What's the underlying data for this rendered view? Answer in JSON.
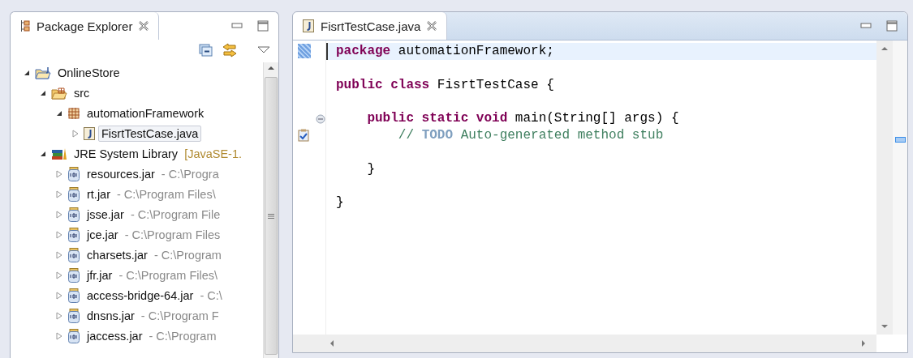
{
  "package_explorer": {
    "tab": {
      "title": "Package Explorer",
      "selected": true
    },
    "tree": [
      {
        "kind": "project",
        "label": "OnlineStore",
        "expanded": true,
        "selected": false,
        "children": [
          {
            "kind": "source-folder",
            "label": "src",
            "expanded": true,
            "selected": false,
            "children": [
              {
                "kind": "package",
                "label": "automationFramework",
                "expanded": true,
                "selected": false,
                "children": [
                  {
                    "kind": "java-file",
                    "label": "FisrtTestCase.java",
                    "expanded": false,
                    "selected": true
                  }
                ]
              }
            ]
          },
          {
            "kind": "library",
            "label": "JRE System Library",
            "decoration": "[JavaSE-1.",
            "expanded": true,
            "selected": false,
            "children": [
              {
                "kind": "jar",
                "label": "resources.jar",
                "decoration": "- C:\\Progra",
                "expanded": false,
                "selected": false
              },
              {
                "kind": "jar",
                "label": "rt.jar",
                "decoration": "- C:\\Program Files\\",
                "expanded": false,
                "selected": false
              },
              {
                "kind": "jar",
                "label": "jsse.jar",
                "decoration": "- C:\\Program File",
                "expanded": false,
                "selected": false
              },
              {
                "kind": "jar",
                "label": "jce.jar",
                "decoration": "- C:\\Program Files",
                "expanded": false,
                "selected": false
              },
              {
                "kind": "jar",
                "label": "charsets.jar",
                "decoration": "- C:\\Program",
                "expanded": false,
                "selected": false
              },
              {
                "kind": "jar",
                "label": "jfr.jar",
                "decoration": "- C:\\Program Files\\",
                "expanded": false,
                "selected": false
              },
              {
                "kind": "jar",
                "label": "access-bridge-64.jar",
                "decoration": "- C:\\",
                "expanded": false,
                "selected": false
              },
              {
                "kind": "jar",
                "label": "dnsns.jar",
                "decoration": "- C:\\Program F",
                "expanded": false,
                "selected": false
              },
              {
                "kind": "jar",
                "label": "jaccess.jar",
                "decoration": "- C:\\Program",
                "expanded": false,
                "selected": false
              }
            ]
          }
        ]
      }
    ]
  },
  "editor": {
    "tab": {
      "title": "FisrtTestCase.java",
      "selected": true
    },
    "lines": [
      {
        "kind": "code",
        "current": true,
        "tokens": [
          {
            "kind": "keyword",
            "text": "package "
          },
          {
            "kind": "plain",
            "text": "automationFramework;"
          }
        ]
      },
      {
        "kind": "blank",
        "current": false
      },
      {
        "kind": "code",
        "current": false,
        "tokens": [
          {
            "kind": "keyword",
            "text": "public class "
          },
          {
            "kind": "plain",
            "text": "FisrtTestCase {"
          }
        ]
      },
      {
        "kind": "blank",
        "current": false
      },
      {
        "kind": "method-start",
        "current": false,
        "tokens": [
          {
            "kind": "keyword",
            "text": "    public static void "
          },
          {
            "kind": "plain",
            "text": "main(String[] args) {"
          }
        ]
      },
      {
        "kind": "task",
        "current": false,
        "tokens": [
          {
            "kind": "comment",
            "text": "        // "
          },
          {
            "kind": "task",
            "text": "TODO"
          },
          {
            "kind": "comment",
            "text": " Auto-generated method stub"
          }
        ]
      },
      {
        "kind": "blank",
        "current": false
      },
      {
        "kind": "code",
        "current": false,
        "tokens": [
          {
            "kind": "plain",
            "text": "    }"
          }
        ]
      },
      {
        "kind": "blank",
        "current": false
      },
      {
        "kind": "code",
        "current": false,
        "tokens": [
          {
            "kind": "plain",
            "text": "}"
          }
        ]
      }
    ]
  }
}
